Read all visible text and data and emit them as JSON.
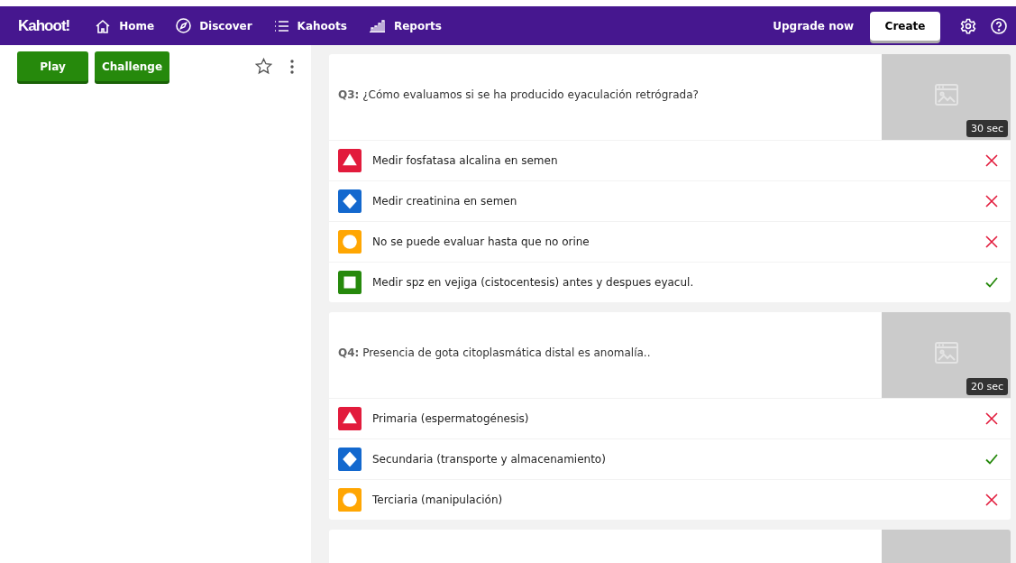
{
  "navbar": {
    "logo": "Kahoot!",
    "links": [
      {
        "label": "Home"
      },
      {
        "label": "Discover"
      },
      {
        "label": "Kahoots"
      },
      {
        "label": "Reports"
      }
    ],
    "upgrade": "Upgrade now",
    "create": "Create"
  },
  "sidebar": {
    "buttons": [
      "Play",
      "Challenge"
    ],
    "favorite": false
  },
  "questions": [
    {
      "kind": "question",
      "text": "**Q3:** ¿Cómo evaluamos si se ha producido eyaculación retrógrada?",
      "time": "30 sec",
      "answers": [
        {
          "kind": "triangle",
          "text": "Medir fosfatasa alcalina en semen",
          "correct": false
        },
        {
          "kind": "diamond",
          "text": "Medir creatinina en semen",
          "correct": false
        },
        {
          "kind": "circle",
          "text": "No se puede evaluar hasta que no orine",
          "correct": false
        },
        {
          "kind": "square",
          "text": "Medir spz en vejiga (cistocentesis) antes y despues eyacul.",
          "correct": true
        }
      ]
    },
    {
      "kind": "question",
      "text": "**Q4:** Presencia de gota citoplasmática distal es anomalía..",
      "time": "20 sec",
      "answers": [
        {
          "kind": "triangle",
          "text": "Primaria (espermatogénesis)",
          "correct": false
        },
        {
          "kind": "diamond",
          "text": "Secundaria (transporte y almacenamiento)",
          "correct": true
        },
        {
          "kind": "circle",
          "text": "Terciaria (manipulación)",
          "correct": false
        }
      ]
    },
    {
      "kind": "cut_off"
    }
  ]
}
